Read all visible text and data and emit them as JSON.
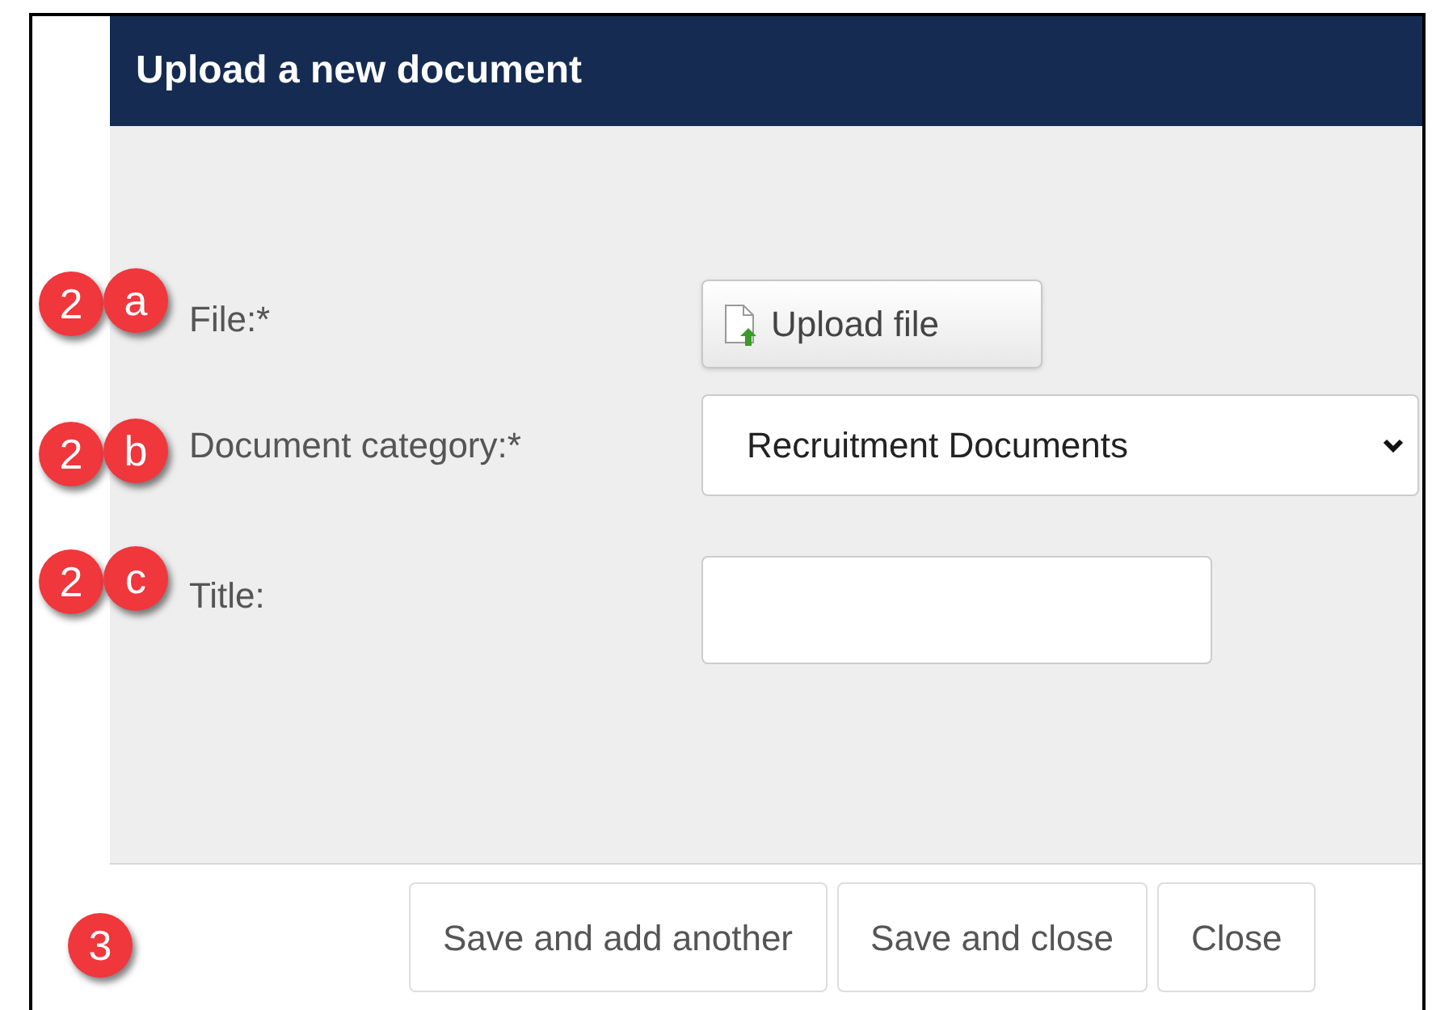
{
  "dialog": {
    "title": "Upload a new document"
  },
  "fields": [
    {
      "kind": "upload",
      "label": "File:*",
      "button": "Upload file",
      "callout": {
        "number": "2",
        "letter": "a"
      }
    },
    {
      "kind": "select",
      "label": "Document category:*",
      "value": "Recruitment Documents",
      "callout": {
        "number": "2",
        "letter": "b"
      }
    },
    {
      "kind": "text",
      "label": "Title:",
      "callout": {
        "number": "2",
        "letter": "c"
      }
    }
  ],
  "footer": {
    "callout": "3",
    "buttons": [
      "Save and add another",
      "Save and close",
      "Close"
    ]
  }
}
